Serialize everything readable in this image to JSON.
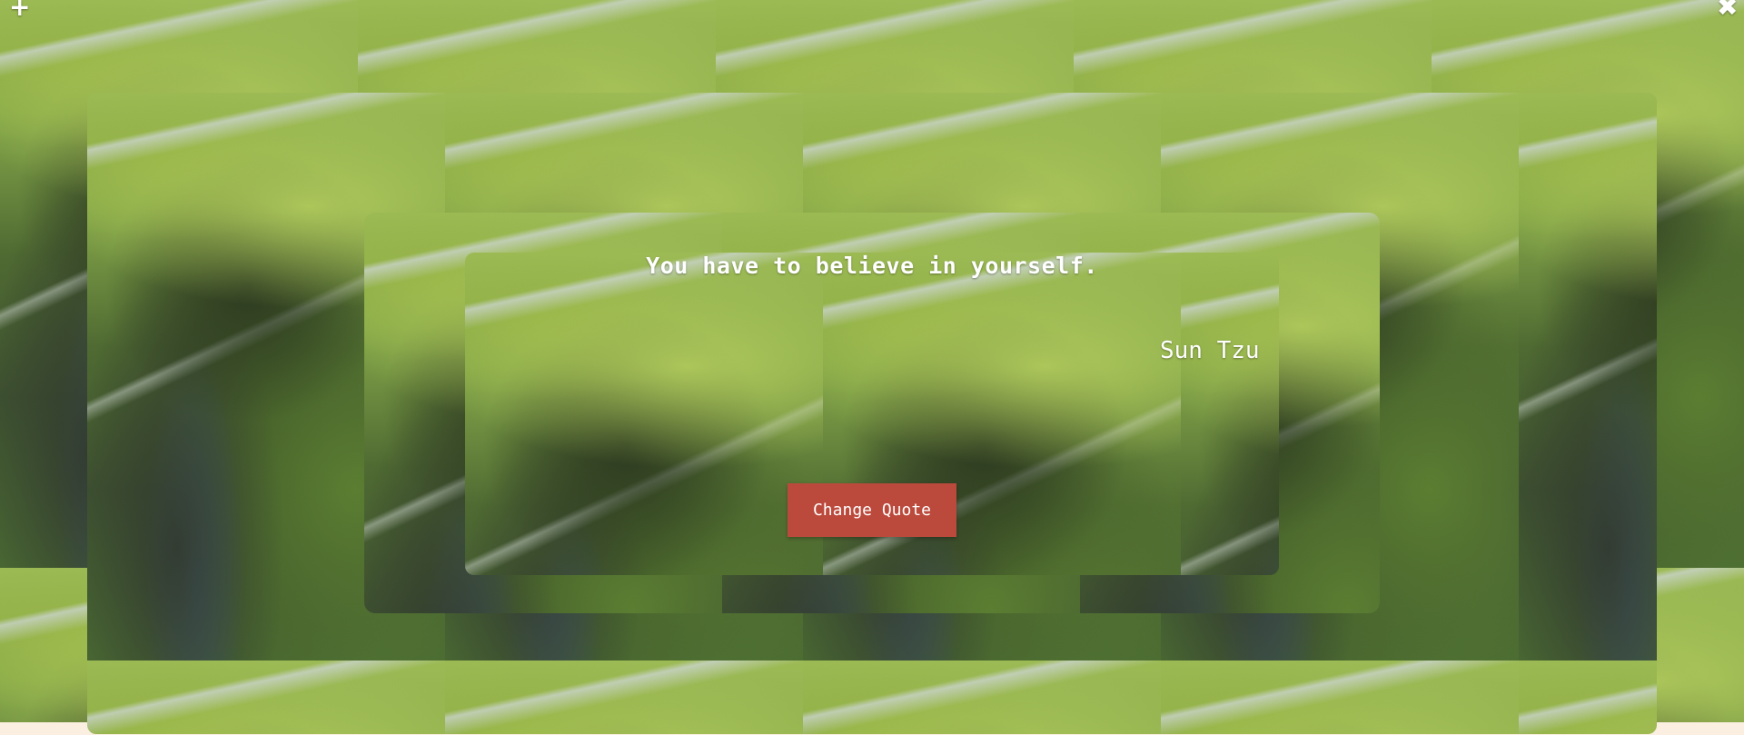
{
  "quote": {
    "text": "You have to believe in yourself.",
    "author": "Sun Tzu"
  },
  "actions": {
    "change_quote_label": "Change Quote",
    "add_icon": "plus-icon",
    "close_icon": "close-icon",
    "add_glyph": "+",
    "close_glyph": "✖"
  },
  "colors": {
    "button": "#bc4a3c",
    "page_background": "#fbefe2",
    "text": "#ffffff"
  },
  "background": {
    "image": "aerial green canyon landscape (tiled)"
  }
}
